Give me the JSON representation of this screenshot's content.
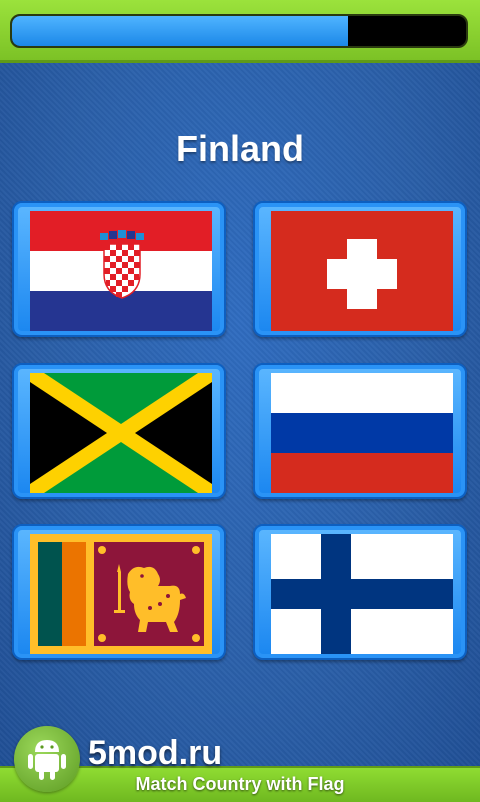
{
  "game": {
    "progress_fraction": 0.74,
    "country_prompt": "Finland",
    "options": [
      {
        "country": "croatia-flag"
      },
      {
        "country": "switzerland-flag"
      },
      {
        "country": "jamaica-flag"
      },
      {
        "country": "russia-flag"
      },
      {
        "country": "sri-lanka-flag"
      },
      {
        "country": "finland-flag"
      }
    ]
  },
  "banner": {
    "app_title": "Match Country with Flag"
  },
  "watermark": {
    "text": "5mod.ru",
    "icon": "android-icon"
  },
  "colors": {
    "top_bar": "#8ed335",
    "progress_fill": "#2b96f5",
    "background": "#2a5fa8",
    "card": "#2a93f6"
  }
}
